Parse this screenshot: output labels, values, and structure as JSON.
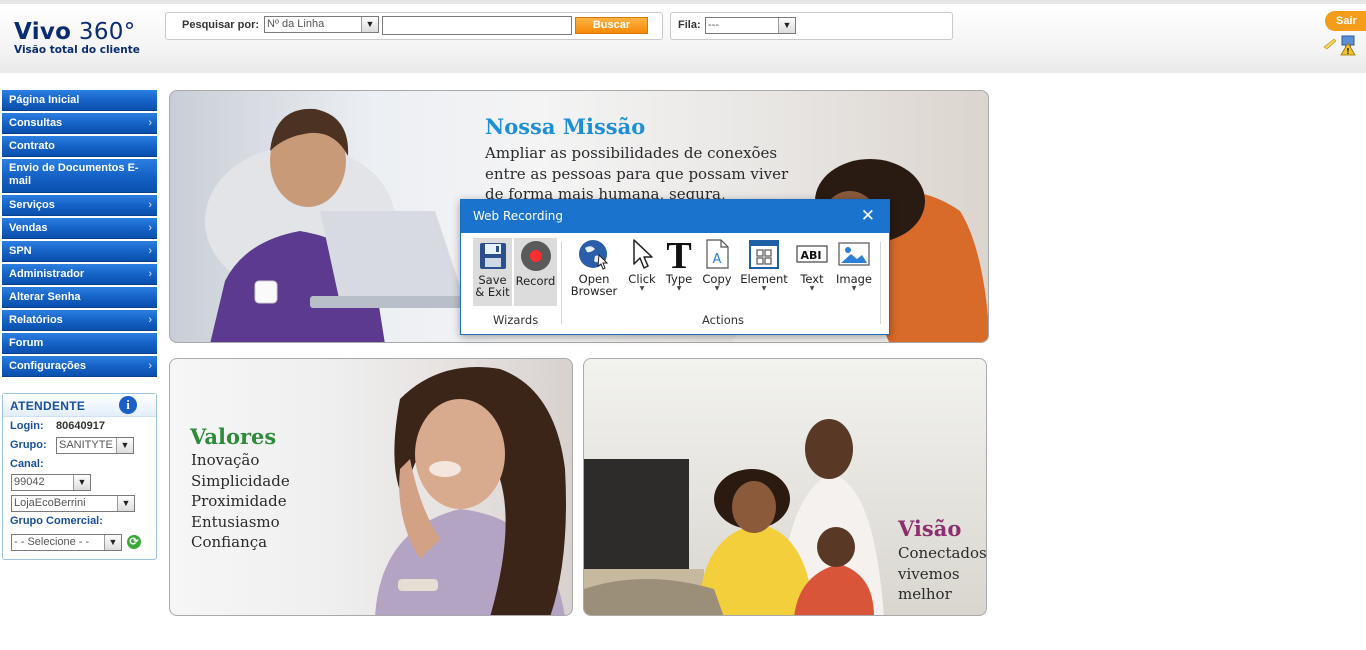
{
  "header": {
    "logo_title_main": "Vivo",
    "logo_title_num": " 360°",
    "logo_subtitle": "Visão total do cliente",
    "search_label": "Pesquisar por:",
    "search_type": "Nº da Linha",
    "search_value": "",
    "search_button": "Buscar",
    "fila_label": "Fila:",
    "fila_value": "---",
    "sair_label": "Sair"
  },
  "menu": {
    "items": [
      {
        "label": "Página Inicial",
        "chevron": ""
      },
      {
        "label": "Consultas",
        "chevron": "›"
      },
      {
        "label": "Contrato",
        "chevron": ""
      },
      {
        "label": "Envio de Documentos E-mail",
        "chevron": ""
      },
      {
        "label": "Serviços",
        "chevron": "›"
      },
      {
        "label": "Vendas",
        "chevron": "›"
      },
      {
        "label": "SPN",
        "chevron": "›"
      },
      {
        "label": "Administrador",
        "chevron": "›"
      },
      {
        "label": "Alterar Senha",
        "chevron": ""
      },
      {
        "label": "Relatórios",
        "chevron": "›"
      },
      {
        "label": "Forum",
        "chevron": ""
      },
      {
        "label": "Configurações",
        "chevron": "›"
      }
    ]
  },
  "atendente": {
    "title": "ATENDENTE",
    "login_label": "Login:",
    "login_value": "80640917",
    "grupo_label": "Grupo:",
    "grupo_value": "SANITYTE",
    "canal_label": "Canal:",
    "canal_value": "99042",
    "loja_value": "LojaEcoBerrini",
    "grupo_comercial_label": "Grupo Comercial:",
    "grupo_comercial_value": "- - Selecione - -"
  },
  "banners": {
    "missao": {
      "heading": "Nossa Missão",
      "line1": "Ampliar as possibilidades de conexões",
      "line2": "entre as pessoas para que possam viver",
      "line3": "de forma mais humana, segura,"
    },
    "valores": {
      "heading": "Valores",
      "items": [
        "Inovação",
        "Simplicidade",
        "Proximidade",
        "Entusiasmo",
        "Confiança"
      ]
    },
    "visao": {
      "heading": "Visão",
      "items": [
        "Conectados",
        "vivemos",
        "melhor"
      ]
    }
  },
  "dialog": {
    "title": "Web Recording",
    "close": "✕",
    "tools": {
      "save_exit_1": "Save",
      "save_exit_2": "& Exit",
      "record": "Record",
      "open_browser_1": "Open",
      "open_browser_2": "Browser",
      "click": "Click",
      "type": "Type",
      "copy": "Copy",
      "element": "Element",
      "text": "Text",
      "image": "Image"
    },
    "groups": {
      "wizards": "Wizards",
      "actions": "Actions"
    }
  },
  "colors": {
    "menu_blue": "#1663c7",
    "brand_navy": "#0b2d6f",
    "accent_orange": "#f58a07",
    "missao_blue": "#1d8fd6",
    "valores_green": "#2f8a3c",
    "visao_purple": "#8c2f6e",
    "dialog_blue": "#1a73cc"
  }
}
